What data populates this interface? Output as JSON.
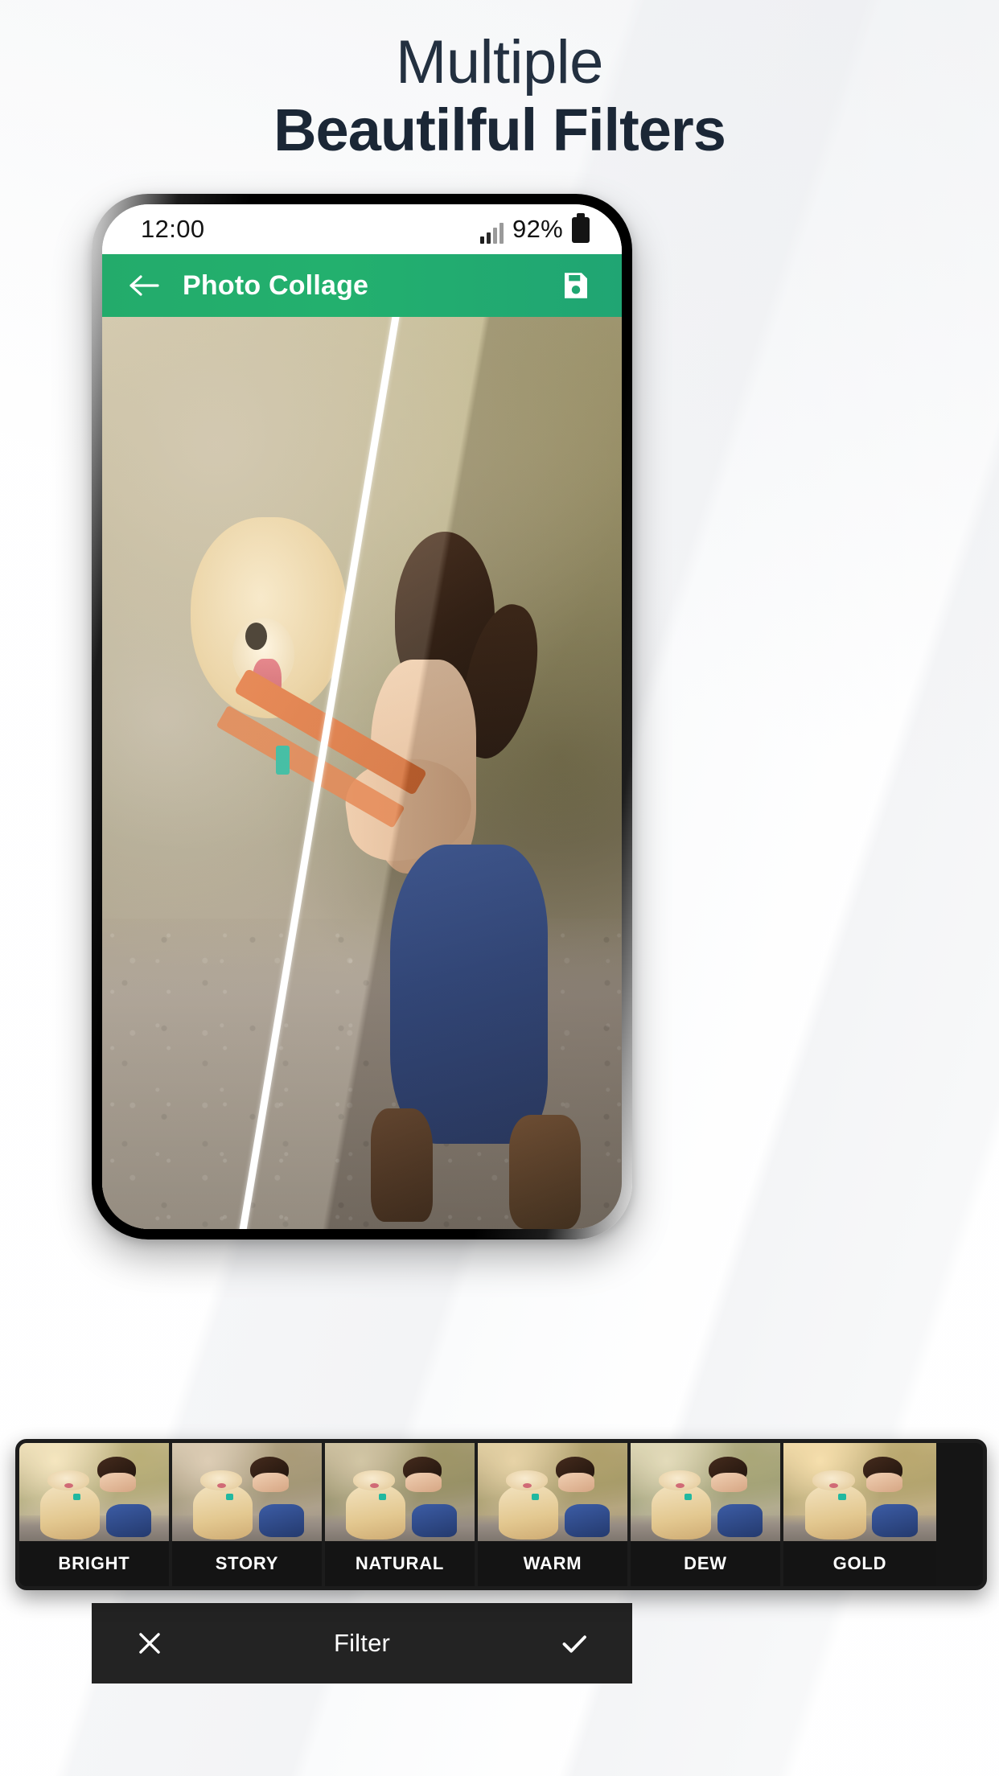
{
  "promo": {
    "headline_line1": "Multiple",
    "headline_line2": "Beautilful Filters",
    "text_color": "#1b2736",
    "background_color": "#fbfbfc"
  },
  "phone": {
    "status_bar": {
      "time": "12:00",
      "battery_percent": "92%",
      "signal_icon": "signal-bars-icon",
      "battery_icon": "battery-icon"
    },
    "app_bar": {
      "back_icon": "arrow-left-icon",
      "title": "Photo Collage",
      "save_icon": "floppy-save-icon",
      "background_color": "#23ab6b"
    },
    "canvas": {
      "description": "Photo of a woman kissing a golden retriever, split diagonally by a white divider line showing filtered versus original",
      "divider": "diagonal-split-line"
    }
  },
  "filter_strip": {
    "items": [
      {
        "label": "BRIGHT",
        "selected": false
      },
      {
        "label": "STORY",
        "selected": false
      },
      {
        "label": "NATURAL",
        "selected": false
      },
      {
        "label": "WARM",
        "selected": true
      },
      {
        "label": "DEW",
        "selected": false
      },
      {
        "label": "GOLD",
        "selected": false
      }
    ]
  },
  "bottom_bar": {
    "cancel_icon": "close-x-icon",
    "title": "Filter",
    "confirm_icon": "check-icon",
    "background_color": "#232323"
  }
}
